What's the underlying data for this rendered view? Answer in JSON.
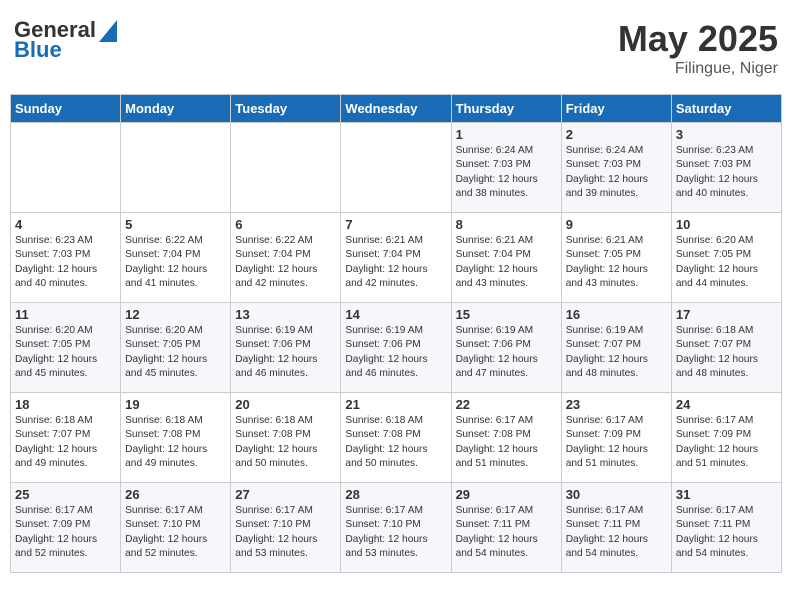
{
  "logo": {
    "general": "General",
    "blue": "Blue"
  },
  "header": {
    "title": "May 2025",
    "subtitle": "Filingue, Niger"
  },
  "days_of_week": [
    "Sunday",
    "Monday",
    "Tuesday",
    "Wednesday",
    "Thursday",
    "Friday",
    "Saturday"
  ],
  "weeks": [
    [
      {
        "day": "",
        "info": ""
      },
      {
        "day": "",
        "info": ""
      },
      {
        "day": "",
        "info": ""
      },
      {
        "day": "",
        "info": ""
      },
      {
        "day": "1",
        "info": "Sunrise: 6:24 AM\nSunset: 7:03 PM\nDaylight: 12 hours\nand 38 minutes."
      },
      {
        "day": "2",
        "info": "Sunrise: 6:24 AM\nSunset: 7:03 PM\nDaylight: 12 hours\nand 39 minutes."
      },
      {
        "day": "3",
        "info": "Sunrise: 6:23 AM\nSunset: 7:03 PM\nDaylight: 12 hours\nand 40 minutes."
      }
    ],
    [
      {
        "day": "4",
        "info": "Sunrise: 6:23 AM\nSunset: 7:03 PM\nDaylight: 12 hours\nand 40 minutes."
      },
      {
        "day": "5",
        "info": "Sunrise: 6:22 AM\nSunset: 7:04 PM\nDaylight: 12 hours\nand 41 minutes."
      },
      {
        "day": "6",
        "info": "Sunrise: 6:22 AM\nSunset: 7:04 PM\nDaylight: 12 hours\nand 42 minutes."
      },
      {
        "day": "7",
        "info": "Sunrise: 6:21 AM\nSunset: 7:04 PM\nDaylight: 12 hours\nand 42 minutes."
      },
      {
        "day": "8",
        "info": "Sunrise: 6:21 AM\nSunset: 7:04 PM\nDaylight: 12 hours\nand 43 minutes."
      },
      {
        "day": "9",
        "info": "Sunrise: 6:21 AM\nSunset: 7:05 PM\nDaylight: 12 hours\nand 43 minutes."
      },
      {
        "day": "10",
        "info": "Sunrise: 6:20 AM\nSunset: 7:05 PM\nDaylight: 12 hours\nand 44 minutes."
      }
    ],
    [
      {
        "day": "11",
        "info": "Sunrise: 6:20 AM\nSunset: 7:05 PM\nDaylight: 12 hours\nand 45 minutes."
      },
      {
        "day": "12",
        "info": "Sunrise: 6:20 AM\nSunset: 7:05 PM\nDaylight: 12 hours\nand 45 minutes."
      },
      {
        "day": "13",
        "info": "Sunrise: 6:19 AM\nSunset: 7:06 PM\nDaylight: 12 hours\nand 46 minutes."
      },
      {
        "day": "14",
        "info": "Sunrise: 6:19 AM\nSunset: 7:06 PM\nDaylight: 12 hours\nand 46 minutes."
      },
      {
        "day": "15",
        "info": "Sunrise: 6:19 AM\nSunset: 7:06 PM\nDaylight: 12 hours\nand 47 minutes."
      },
      {
        "day": "16",
        "info": "Sunrise: 6:19 AM\nSunset: 7:07 PM\nDaylight: 12 hours\nand 48 minutes."
      },
      {
        "day": "17",
        "info": "Sunrise: 6:18 AM\nSunset: 7:07 PM\nDaylight: 12 hours\nand 48 minutes."
      }
    ],
    [
      {
        "day": "18",
        "info": "Sunrise: 6:18 AM\nSunset: 7:07 PM\nDaylight: 12 hours\nand 49 minutes."
      },
      {
        "day": "19",
        "info": "Sunrise: 6:18 AM\nSunset: 7:08 PM\nDaylight: 12 hours\nand 49 minutes."
      },
      {
        "day": "20",
        "info": "Sunrise: 6:18 AM\nSunset: 7:08 PM\nDaylight: 12 hours\nand 50 minutes."
      },
      {
        "day": "21",
        "info": "Sunrise: 6:18 AM\nSunset: 7:08 PM\nDaylight: 12 hours\nand 50 minutes."
      },
      {
        "day": "22",
        "info": "Sunrise: 6:17 AM\nSunset: 7:08 PM\nDaylight: 12 hours\nand 51 minutes."
      },
      {
        "day": "23",
        "info": "Sunrise: 6:17 AM\nSunset: 7:09 PM\nDaylight: 12 hours\nand 51 minutes."
      },
      {
        "day": "24",
        "info": "Sunrise: 6:17 AM\nSunset: 7:09 PM\nDaylight: 12 hours\nand 51 minutes."
      }
    ],
    [
      {
        "day": "25",
        "info": "Sunrise: 6:17 AM\nSunset: 7:09 PM\nDaylight: 12 hours\nand 52 minutes."
      },
      {
        "day": "26",
        "info": "Sunrise: 6:17 AM\nSunset: 7:10 PM\nDaylight: 12 hours\nand 52 minutes."
      },
      {
        "day": "27",
        "info": "Sunrise: 6:17 AM\nSunset: 7:10 PM\nDaylight: 12 hours\nand 53 minutes."
      },
      {
        "day": "28",
        "info": "Sunrise: 6:17 AM\nSunset: 7:10 PM\nDaylight: 12 hours\nand 53 minutes."
      },
      {
        "day": "29",
        "info": "Sunrise: 6:17 AM\nSunset: 7:11 PM\nDaylight: 12 hours\nand 54 minutes."
      },
      {
        "day": "30",
        "info": "Sunrise: 6:17 AM\nSunset: 7:11 PM\nDaylight: 12 hours\nand 54 minutes."
      },
      {
        "day": "31",
        "info": "Sunrise: 6:17 AM\nSunset: 7:11 PM\nDaylight: 12 hours\nand 54 minutes."
      }
    ]
  ]
}
